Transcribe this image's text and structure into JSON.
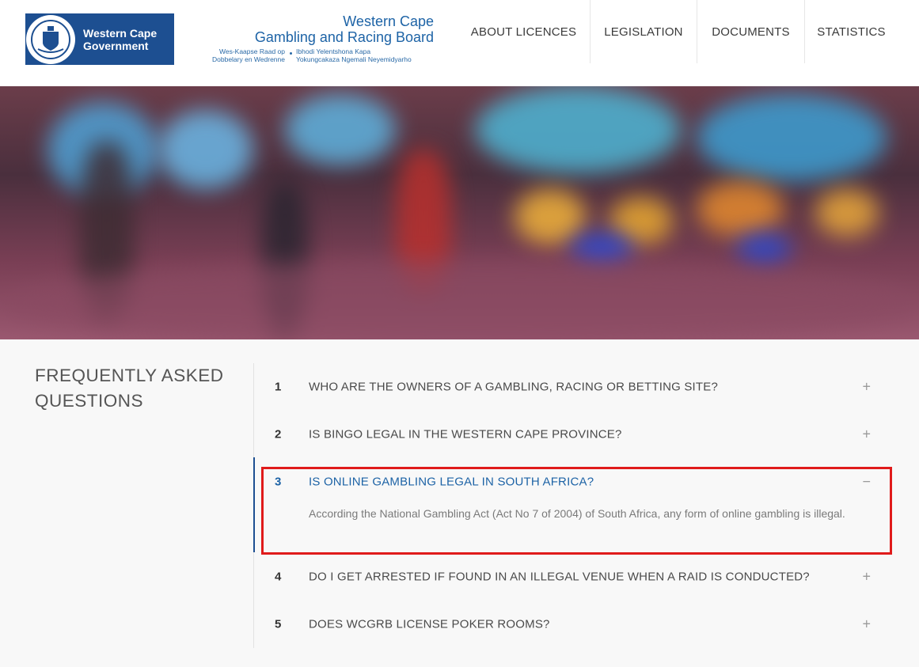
{
  "header": {
    "gov_logo": {
      "line1": "Western Cape",
      "line2": "Government"
    },
    "board": {
      "title_line1": "Western Cape",
      "title_line2": "Gambling and Racing Board",
      "sub_afrikaans_1": "Wes-Kaapse Raad op",
      "sub_afrikaans_2": "Dobbelary en Wedrenne",
      "sub_xhosa_1": "Ibhodi Yelentshona Kapa",
      "sub_xhosa_2": "Yokungcakaza Ngemali Neyemidyarho"
    },
    "nav": [
      {
        "label": "ABOUT LICENCES"
      },
      {
        "label": "LEGISLATION"
      },
      {
        "label": "DOCUMENTS"
      },
      {
        "label": "STATISTICS"
      }
    ]
  },
  "hero": {
    "image": "blurred-casino-slot-machines"
  },
  "faq": {
    "title": "FREQUENTLY ASKED QUESTIONS",
    "items": [
      {
        "num": "1",
        "question": "WHO ARE THE OWNERS OF A GAMBLING, RACING OR BETTING SITE?",
        "toggle": "+"
      },
      {
        "num": "2",
        "question": "IS BINGO LEGAL IN THE WESTERN CAPE PROVINCE?",
        "toggle": "+"
      },
      {
        "num": "3",
        "question": "IS ONLINE GAMBLING LEGAL IN SOUTH AFRICA?",
        "toggle": "−",
        "answer": "According the National Gambling Act (Act No 7 of 2004) of South Africa, any form of online gambling is illegal."
      },
      {
        "num": "4",
        "question": "DO I GET ARRESTED IF FOUND IN AN ILLEGAL VENUE WHEN A RAID IS CONDUCTED?",
        "toggle": "+"
      },
      {
        "num": "5",
        "question": "DOES WCGRB LICENSE POKER ROOMS?",
        "toggle": "+"
      }
    ]
  },
  "colors": {
    "brand_blue": "#1d4f91",
    "link_blue": "#1d63a6",
    "highlight_red": "#e01b1b"
  }
}
